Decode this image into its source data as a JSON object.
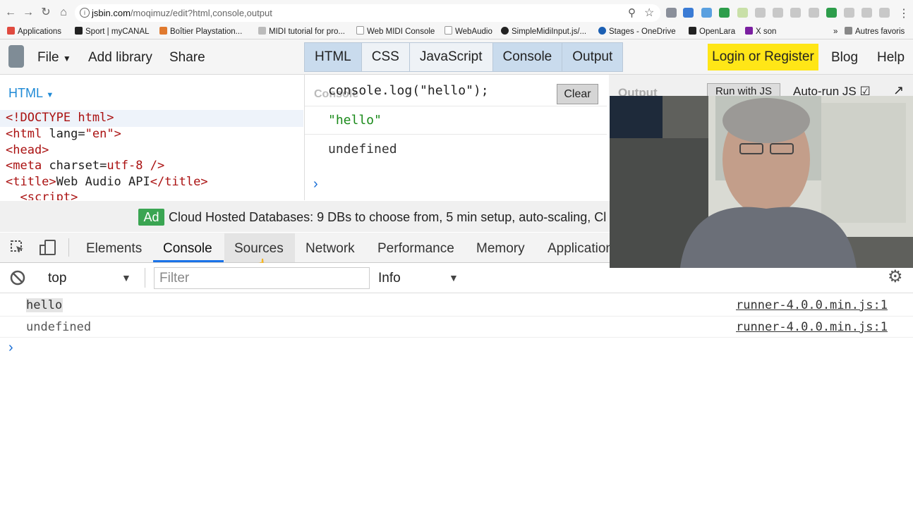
{
  "browser": {
    "url_host": "jsbin.com",
    "url_path": "/moqimuz/edit?html,console,output",
    "bookmarks": [
      "Applications",
      "Sport | myCANAL",
      "Boîtier Playstation...",
      "MIDI tutorial for pro...",
      "Web MIDI Console",
      "WebAudio",
      "SimpleMidiInput.js/...",
      "Stages - OneDrive",
      "OpenLara",
      "X son"
    ],
    "bookmarks_more": "»",
    "other_bookmarks": "Autres favoris"
  },
  "jsbin": {
    "file": "File",
    "add_library": "Add library",
    "share": "Share",
    "panels": [
      "HTML",
      "CSS",
      "JavaScript",
      "Console",
      "Output"
    ],
    "login": "Login or Register",
    "blog": "Blog",
    "help": "Help",
    "html_panel_label": "HTML",
    "output_label": "Output",
    "run_with_js": "Run with JS",
    "auto_run": "Auto-run JS"
  },
  "console_panel": {
    "ghost_label": "Console",
    "input": "console.log(\"hello\");",
    "out1": "\"hello\"",
    "out2": "undefined",
    "clear": "Clear"
  },
  "ad": {
    "badge": "Ad",
    "text": "Cloud Hosted Databases: 9 DBs to choose from, 5 min setup, auto-scaling, Cl"
  },
  "devtools": {
    "tabs": [
      "Elements",
      "Console",
      "Sources",
      "Network",
      "Performance",
      "Memory",
      "Application"
    ],
    "context": "top",
    "filter_placeholder": "Filter",
    "level": "Info",
    "logs": [
      {
        "text": "hello",
        "source": "runner-4.0.0.min.js:1"
      },
      {
        "text": "undefined",
        "source": "runner-4.0.0.min.js:1"
      }
    ]
  },
  "colors": {
    "accent": "#1a73e8",
    "login_bg": "#ffe617",
    "ad_green": "#3aa552",
    "jsbin_html": "#1f8ad6"
  }
}
